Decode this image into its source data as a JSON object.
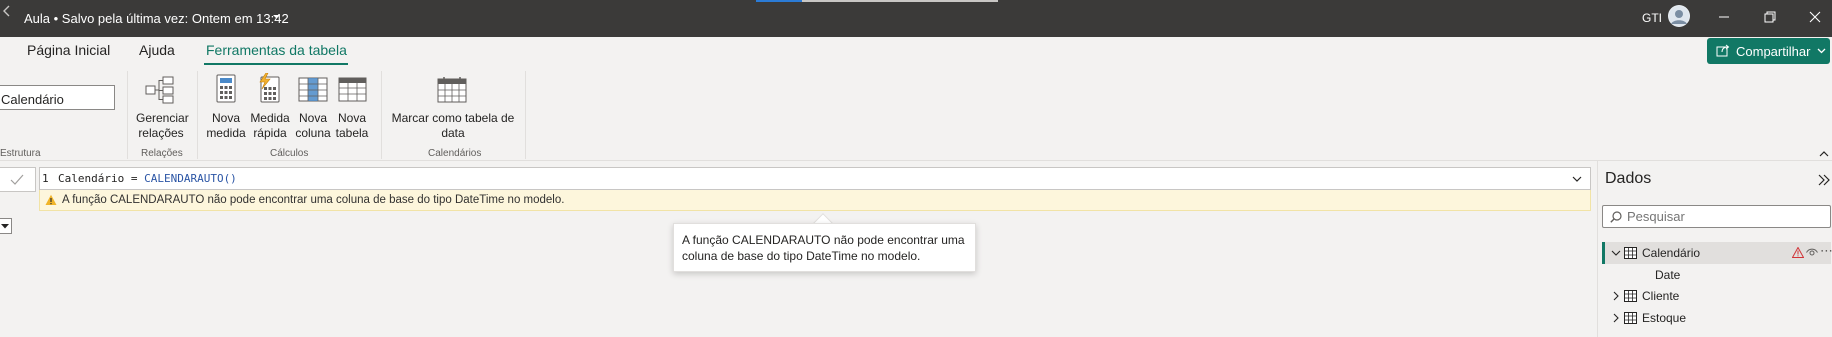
{
  "titlebar": {
    "title": "Aula • Salvo pela última vez: Ontem em 13:42",
    "user": "GTI",
    "progress_fraction": 0.19
  },
  "ribbon_tabs": [
    {
      "label": "Página Inicial"
    },
    {
      "label": "Ajuda"
    },
    {
      "label": "Ferramentas da tabela"
    }
  ],
  "share": {
    "label": "Compartilhar"
  },
  "ribbon": {
    "name_value": "Calendário",
    "groups": {
      "estrutura": "Estrutura",
      "relacoes": "Relações",
      "calculos": "Cálculos",
      "calendarios": "Calendários"
    },
    "buttons": {
      "gerenciar": [
        "Gerenciar",
        "relações"
      ],
      "nova_medida": [
        "Nova",
        "medida"
      ],
      "medida_rapida": [
        "Medida",
        "rápida"
      ],
      "nova_coluna": [
        "Nova",
        "coluna"
      ],
      "nova_tabela": [
        "Nova",
        "tabela"
      ],
      "marcar": [
        "Marcar como tabela de",
        "data"
      ]
    }
  },
  "formula": {
    "line_number": "1",
    "lhs": "Calendário = ",
    "fn": "CALENDARAUTO()"
  },
  "warning": {
    "text": "A função CALENDARAUTO não pode encontrar uma coluna de base do tipo DateTime no modelo."
  },
  "tooltip": {
    "line1": "A função CALENDARAUTO não pode encontrar uma",
    "line2": "coluna de base do tipo DateTime no modelo."
  },
  "data_pane": {
    "title": "Dados",
    "search_placeholder": "Pesquisar",
    "tables": [
      {
        "name": "Calendário",
        "fields": [
          "Date"
        ]
      },
      {
        "name": "Cliente"
      },
      {
        "name": "Estoque"
      }
    ]
  },
  "colors": {
    "accent": "#117865",
    "titlebar": "#3b3a39",
    "warning_bg": "#fdf6dc",
    "error": "#d13438",
    "function_blue": "#2b55a5"
  }
}
